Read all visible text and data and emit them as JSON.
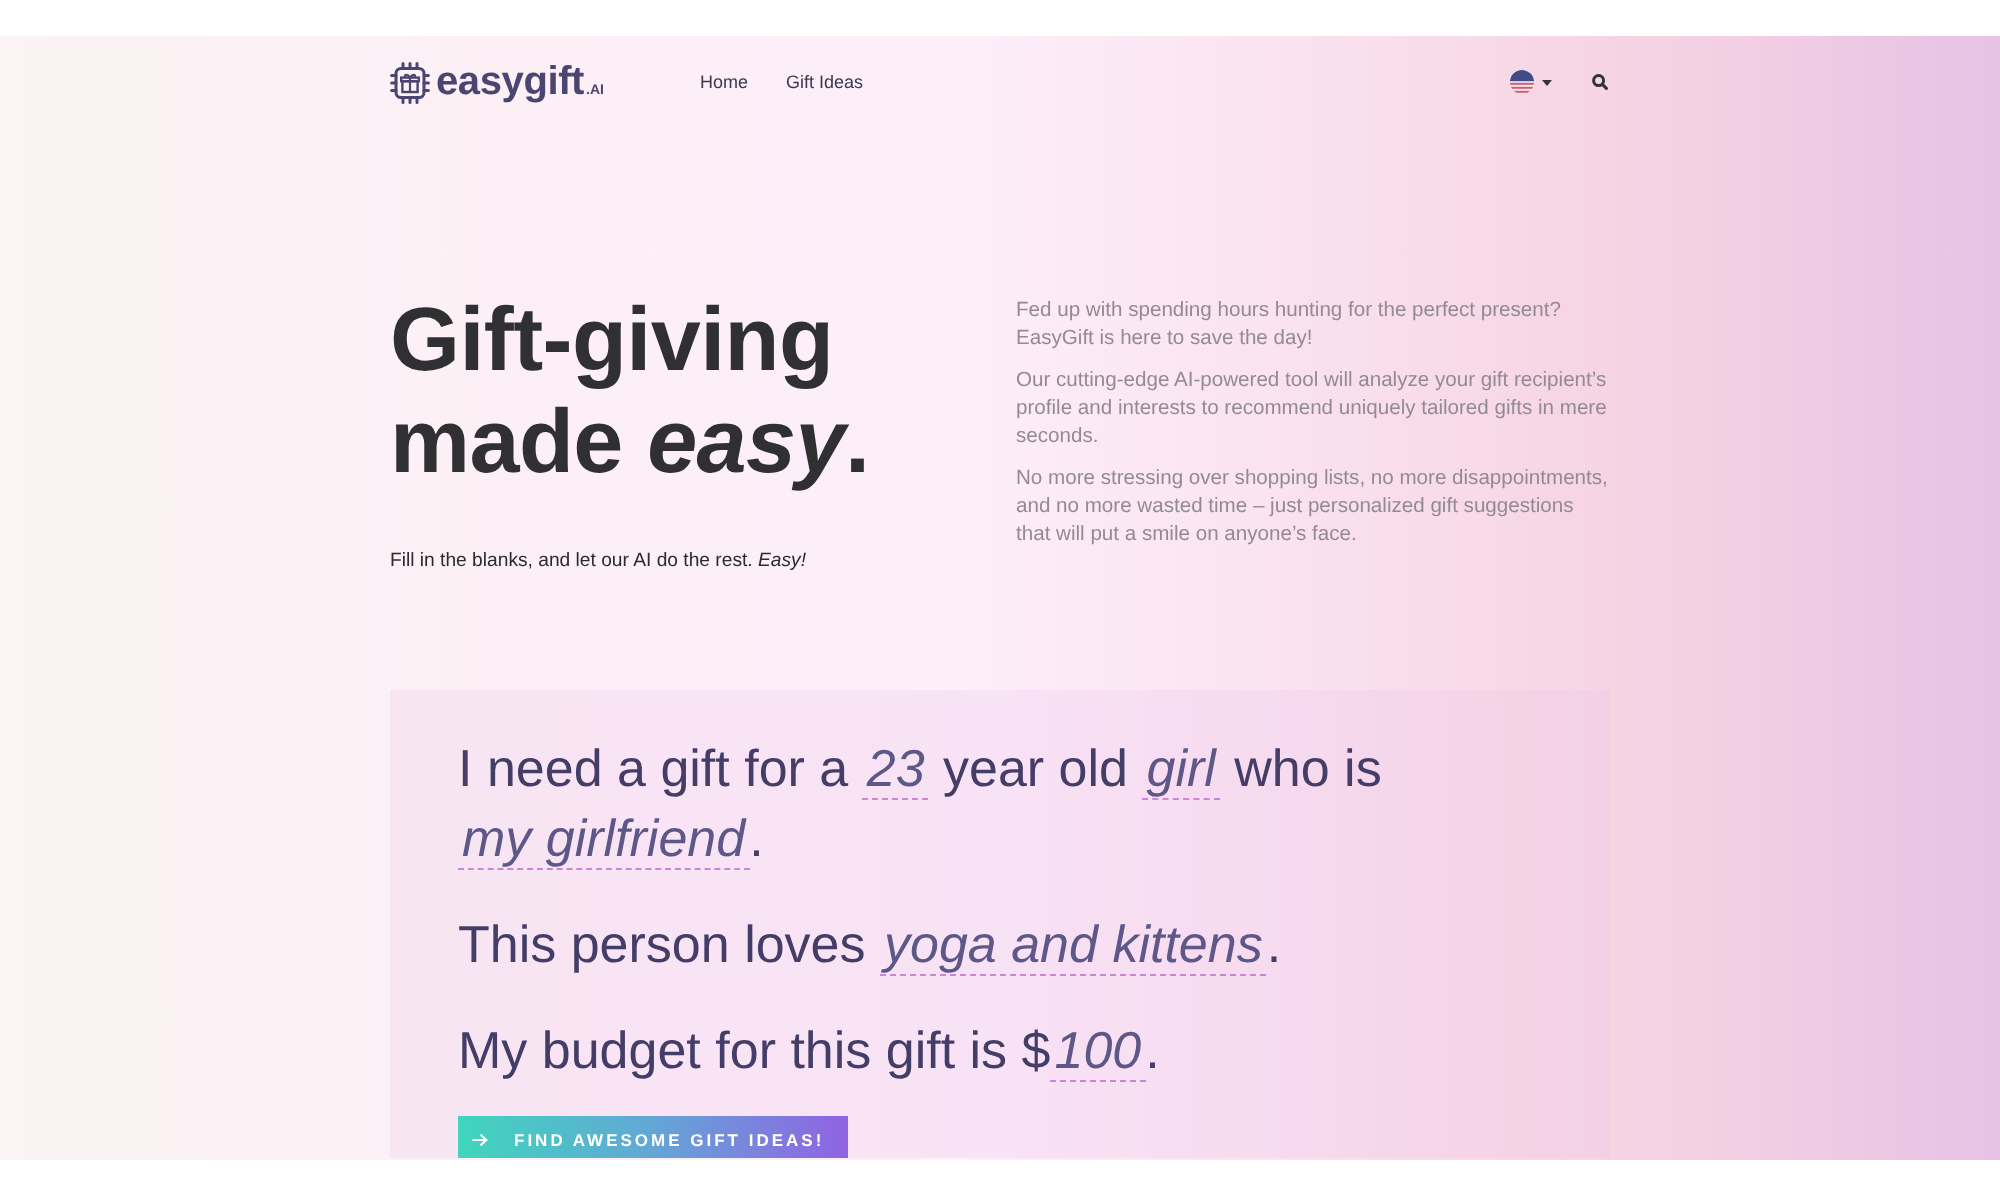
{
  "header": {
    "logo": {
      "text": "easygift",
      "suffix": ".AI"
    },
    "nav_links": [
      {
        "label": "Home"
      },
      {
        "label": "Gift Ideas"
      }
    ]
  },
  "hero": {
    "heading": "Gift-giving made *easy*.",
    "tagline": "Fill in the blanks, and let our AI do the rest. *Easy!*",
    "paragraphs": [
      "Fed up with spending hours hunting for the perfect present? EasyGift is here to save the day!",
      "Our cutting-edge AI-powered tool will analyze your gift recipient’s profile and interests to recommend uniquely tailored gifts in mere seconds.",
      "No more stressing over shopping lists, no more disappointments, and no more wasted time – just personalized gift suggestions that will put a smile on anyone’s face."
    ]
  },
  "gift_form": {
    "sentences": [
      {
        "parts": [
          {
            "kind": "text",
            "text": "I need a gift for a "
          },
          {
            "kind": "blank",
            "value": "23"
          },
          {
            "kind": "text",
            "text": " year old "
          },
          {
            "kind": "blank",
            "value": "girl"
          },
          {
            "kind": "text",
            "text": " who is "
          },
          {
            "kind": "blank",
            "value": "my girlfriend"
          },
          {
            "kind": "text",
            "text": "."
          }
        ]
      },
      {
        "parts": [
          {
            "kind": "text",
            "text": "This person loves "
          },
          {
            "kind": "blank",
            "value": "yoga and kittens"
          },
          {
            "kind": "text",
            "text": "."
          }
        ]
      },
      {
        "parts": [
          {
            "kind": "text",
            "text": "My budget for this gift is $"
          },
          {
            "kind": "blank",
            "value": "100"
          },
          {
            "kind": "text",
            "text": "."
          }
        ]
      }
    ],
    "submit_button": {
      "label": "FIND AWESOME GIFT IDEAS!"
    }
  }
}
